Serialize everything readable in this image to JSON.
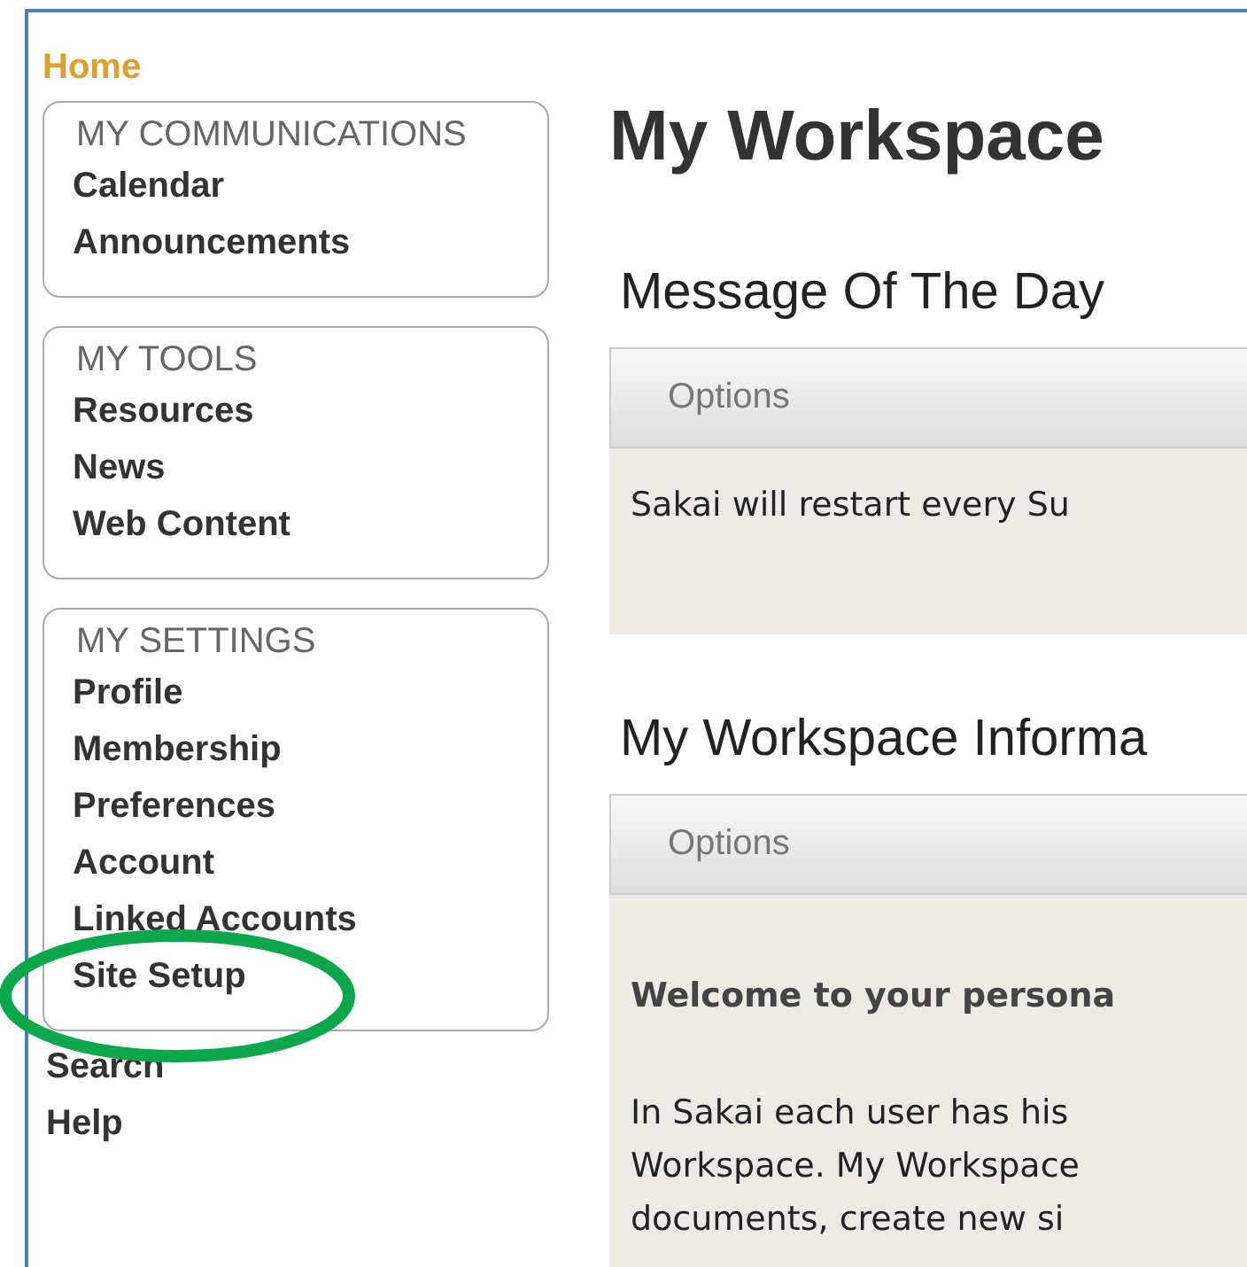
{
  "home": "Home",
  "groups": [
    {
      "heading": "MY COMMUNICATIONS",
      "items": [
        "Calendar",
        "Announcements"
      ]
    },
    {
      "heading": "MY TOOLS",
      "items": [
        "Resources",
        "News",
        "Web Content"
      ]
    },
    {
      "heading": "MY SETTINGS",
      "items": [
        "Profile",
        "Membership",
        "Preferences",
        "Account",
        "Linked Accounts",
        "Site Setup"
      ]
    }
  ],
  "links": [
    "Search",
    "Help"
  ],
  "page_title": "My Workspace",
  "portlets": [
    {
      "title": "Message Of The Day",
      "toolbar": "Options",
      "body": [
        {
          "kind": "text",
          "text": "Sakai will restart every Su"
        }
      ]
    },
    {
      "title": "My Workspace Informa",
      "toolbar": "Options",
      "body": [
        {
          "kind": "heading",
          "text": "Welcome to your persona"
        },
        {
          "kind": "paragraph",
          "lines": [
            "In Sakai each user has his",
            "Workspace. My Workspace",
            "documents, create new si"
          ]
        }
      ]
    }
  ],
  "annotation": {
    "kind": "ellipse"
  }
}
